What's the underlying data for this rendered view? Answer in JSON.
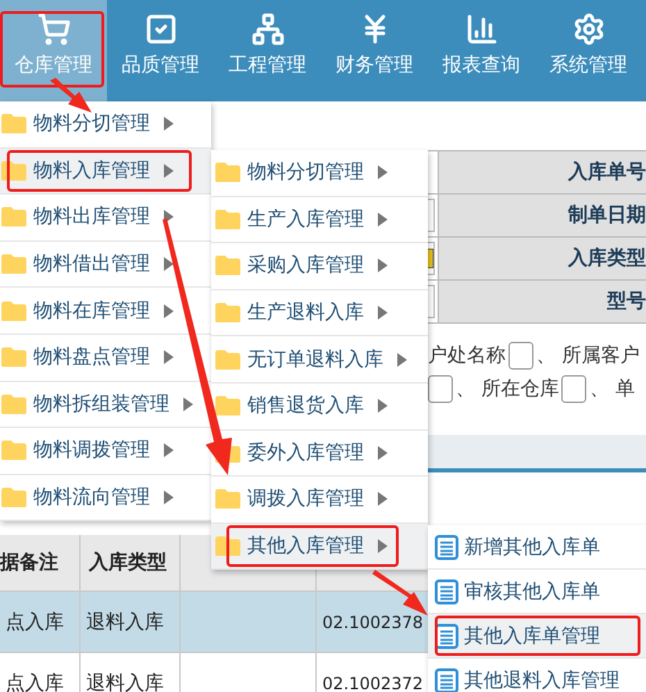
{
  "nav": [
    {
      "label": "仓库管理",
      "selected": true,
      "annotated": true
    },
    {
      "label": "品质管理",
      "selected": false,
      "annotated": false
    },
    {
      "label": "工程管理",
      "selected": false,
      "annotated": false
    },
    {
      "label": "财务管理",
      "selected": false,
      "annotated": false
    },
    {
      "label": "报表查询",
      "selected": false,
      "annotated": false
    },
    {
      "label": "系统管理",
      "selected": false,
      "annotated": false
    }
  ],
  "form": {
    "rows": [
      {
        "label": "入库单号"
      },
      {
        "label": "制单日期",
        "kind": "input"
      },
      {
        "label": "入库类型",
        "kind": "picker"
      },
      {
        "label": "型号",
        "kind": "input"
      }
    ]
  },
  "filters": [
    [
      {
        "kind": "text",
        "text": "户处名称"
      },
      {
        "kind": "box"
      },
      {
        "kind": "text",
        "text": "、 所属客户"
      }
    ],
    [
      {
        "kind": "box"
      },
      {
        "kind": "text",
        "text": "、 所在仓库"
      },
      {
        "kind": "box"
      },
      {
        "kind": "text",
        "text": "、 单"
      }
    ]
  ],
  "table": {
    "columns": [
      "据备注",
      "入库类型",
      null,
      null
    ],
    "rows": [
      {
        "cells": [
          "点入库",
          "退料入库",
          null,
          "02.1002378"
        ],
        "selected": true
      },
      {
        "cells": [
          "点入库",
          "退料入库",
          null,
          "02.1002372"
        ],
        "selected": false
      }
    ]
  },
  "menus": [
    {
      "items": [
        {
          "label": "物料分切管理",
          "kind": "folder",
          "selected": false,
          "annotated": false
        },
        {
          "label": "物料入库管理",
          "kind": "folder",
          "selected": true,
          "annotated": true
        },
        {
          "label": "物料出库管理",
          "kind": "folder",
          "selected": false,
          "annotated": false
        },
        {
          "label": "物料借出管理",
          "kind": "folder",
          "selected": false,
          "annotated": false
        },
        {
          "label": "物料在库管理",
          "kind": "folder",
          "selected": false,
          "annotated": false
        },
        {
          "label": "物料盘点管理",
          "kind": "folder",
          "selected": false,
          "annotated": false
        },
        {
          "label": "物料拆组装管理",
          "kind": "folder",
          "selected": false,
          "annotated": false
        },
        {
          "label": "物料调拨管理",
          "kind": "folder",
          "selected": false,
          "annotated": false
        },
        {
          "label": "物料流向管理",
          "kind": "folder",
          "selected": false,
          "annotated": false
        }
      ]
    },
    {
      "items": [
        {
          "label": "物料分切管理",
          "kind": "folder",
          "selected": false,
          "annotated": false
        },
        {
          "label": "生产入库管理",
          "kind": "folder",
          "selected": false,
          "annotated": false
        },
        {
          "label": "采购入库管理",
          "kind": "folder",
          "selected": false,
          "annotated": false
        },
        {
          "label": "生产退料入库",
          "kind": "folder",
          "selected": false,
          "annotated": false
        },
        {
          "label": "无订单退料入库",
          "kind": "folder",
          "selected": false,
          "annotated": false
        },
        {
          "label": "销售退货入库",
          "kind": "folder",
          "selected": false,
          "annotated": false
        },
        {
          "label": "委外入库管理",
          "kind": "folder",
          "selected": false,
          "annotated": false
        },
        {
          "label": "调拨入库管理",
          "kind": "folder",
          "selected": false,
          "annotated": false
        },
        {
          "label": "其他入库管理",
          "kind": "folder",
          "selected": true,
          "annotated": true
        }
      ]
    },
    {
      "items": [
        {
          "label": "新增其他入库单",
          "kind": "document",
          "selected": false,
          "annotated": false
        },
        {
          "label": "审核其他入库单",
          "kind": "document",
          "selected": false,
          "annotated": false
        },
        {
          "label": "其他入库单管理",
          "kind": "document",
          "selected": true,
          "annotated": true
        },
        {
          "label": "其他退料入库管理",
          "kind": "document",
          "selected": false,
          "annotated": false
        }
      ]
    }
  ]
}
